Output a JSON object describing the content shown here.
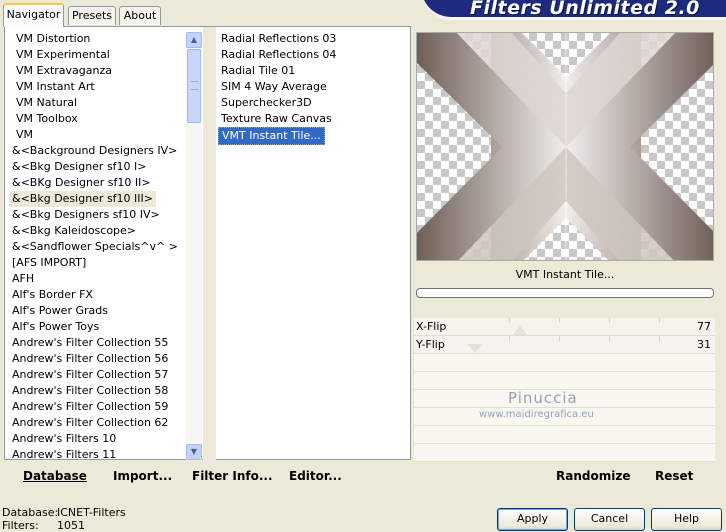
{
  "banner": {
    "title": "Filters Unlimited 2.0"
  },
  "tabs": [
    {
      "label": "Navigator",
      "active": true
    },
    {
      "label": "Presets",
      "active": false
    },
    {
      "label": "About",
      "active": false
    }
  ],
  "categories": [
    "VM Distortion",
    "VM Experimental",
    "VM Extravaganza",
    "VM Instant Art",
    "VM Natural",
    "VM Toolbox",
    "VM",
    "&<Background Designers IV>",
    "&<Bkg Designer sf10 I>",
    "&<BKg Designer sf10 II>",
    "&<Bkg Designer sf10 III>",
    "&<Bkg Designers sf10 IV>",
    "&<Bkg Kaleidoscope>",
    "&<Sandflower Specials^v^ >",
    "[AFS IMPORT]",
    "AFH",
    "Alf's Border FX",
    "Alf's Power Grads",
    "Alf's Power Toys",
    "Andrew's Filter Collection 55",
    "Andrew's Filter Collection 56",
    "Andrew's Filter Collection 57",
    "Andrew's Filter Collection 58",
    "Andrew's Filter Collection 59",
    "Andrew's Filter Collection 62",
    "Andrew's Filters 10",
    "Andrew's Filters 11"
  ],
  "selected_category_index": 10,
  "filters": [
    "Radial Reflections 03",
    "Radial Reflections 04",
    "Radial Tile 01",
    "SIM 4 Way Average",
    "Superchecker3D",
    "Texture Raw Canvas",
    "VMT Instant Tile..."
  ],
  "selected_filter_index": 6,
  "preview": {
    "filter_name": "VMT Instant Tile...",
    "colors": {
      "dark": "#6f5f58",
      "mid": "#a89890",
      "light": "#f2eeec"
    }
  },
  "sliders": [
    {
      "label": "X-Flip",
      "value": "77",
      "level_fraction": 0.302
    },
    {
      "label": "Y-Flip",
      "value": "31",
      "level_fraction": 0.122
    }
  ],
  "watermark": {
    "line1": "Pinuccia",
    "line2": "www.maidiregrafica.eu"
  },
  "toolbar": {
    "database": "Database",
    "import": "Import...",
    "filter_info": "Filter Info...",
    "editor": "Editor...",
    "randomize": "Randomize",
    "reset": "Reset"
  },
  "status": {
    "database_label": "Database:",
    "database_value": "ICNET-Filters",
    "filters_label": "Filters:",
    "filters_value": "1051"
  },
  "buttons": {
    "apply": "Apply",
    "cancel": "Cancel",
    "help": "Help"
  }
}
